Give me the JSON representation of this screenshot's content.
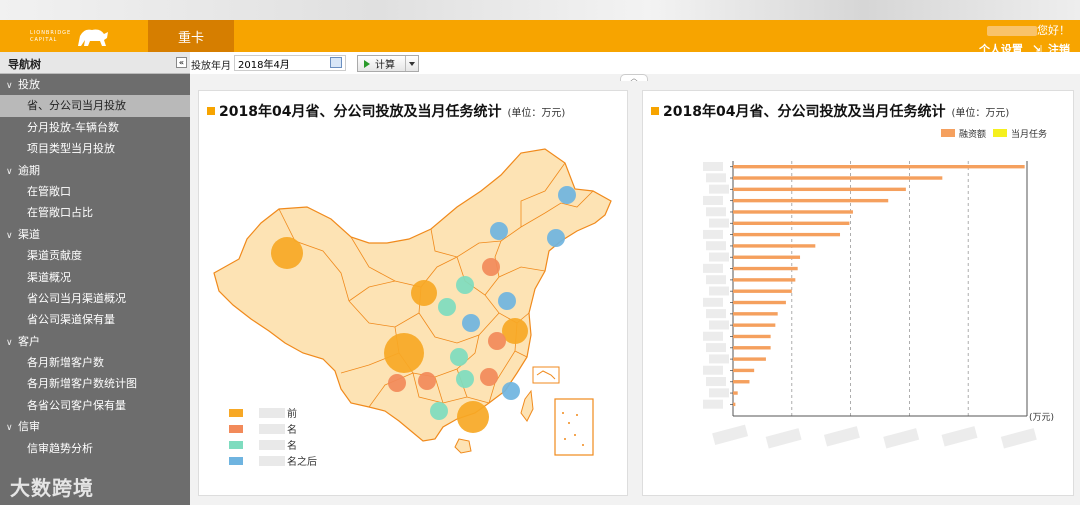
{
  "header": {
    "logo_line1": "LIONBRIDGE",
    "logo_line2": "CAPITAL",
    "active_tab": "重卡",
    "greeting": "您好！",
    "settings_link": "个人设置",
    "logout_link": "注销"
  },
  "sidebar": {
    "title": "导航树",
    "groups": [
      {
        "label": "投放",
        "items": [
          "省、分公司当月投放",
          "分月投放-车辆台数",
          "项目类型当月投放"
        ]
      },
      {
        "label": "逾期",
        "items": [
          "在管敞口",
          "在管敞口占比"
        ]
      },
      {
        "label": "渠道",
        "items": [
          "渠道贡献度",
          "渠道概况",
          "省公司当月渠道概况",
          "省公司渠道保有量"
        ]
      },
      {
        "label": "客户",
        "items": [
          "各月新增客户数",
          "各月新增客户数统计图",
          "各省公司客户保有量"
        ]
      },
      {
        "label": "信审",
        "items": [
          "信审趋势分析"
        ]
      }
    ],
    "active_item": "省、分公司当月投放",
    "watermark": "大数跨境"
  },
  "toolbar": {
    "period_label": "投放年月",
    "period_value": "2018年4月",
    "calc_label": "计算"
  },
  "left_panel": {
    "title": "2018年04月省、分公司投放及当月任务统计",
    "unit": "(单位：万元)",
    "legend": [
      {
        "label": "前",
        "color": "#f7a825"
      },
      {
        "label": "名",
        "color": "#f28a5a"
      },
      {
        "label": "名",
        "color": "#7edcbf"
      },
      {
        "label": "名之后",
        "color": "#6fb4e0"
      }
    ]
  },
  "right_panel": {
    "title": "2018年04月省、分公司投放及当月任务统计",
    "unit": "(单位：万元)",
    "legend": [
      {
        "label": "融资额",
        "color": "#f5a05e"
      },
      {
        "label": "当月任务",
        "color": "#f5f01e"
      }
    ],
    "xunit": "(万元)"
  },
  "chart_data": {
    "type": "bar",
    "orientation": "horizontal",
    "series": [
      {
        "name": "融资额",
        "color": "#f5a05e",
        "values": [
          248,
          178,
          147,
          132,
          102,
          99,
          91,
          70,
          57,
          55,
          53,
          50,
          45,
          38,
          36,
          32,
          32,
          28,
          18,
          14,
          4,
          2
        ]
      },
      {
        "name": "当月任务",
        "color": "#f5f01e",
        "values": []
      }
    ],
    "category_labels_visible": false,
    "grid": "vertical-dashed",
    "xunit": "(万元)"
  },
  "map_data": {
    "type": "bubble-map",
    "region": "China",
    "bubbles": [
      {
        "color_group": 0,
        "size": "large"
      },
      {
        "color_group": 0,
        "size": "xlarge"
      },
      {
        "color_group": 0,
        "size": "large"
      },
      {
        "color_group": 0,
        "size": "medium"
      },
      {
        "color_group": 0,
        "size": "medium"
      },
      {
        "color_group": 1,
        "size": "small"
      },
      {
        "color_group": 1,
        "size": "small"
      },
      {
        "color_group": 1,
        "size": "small"
      },
      {
        "color_group": 1,
        "size": "small"
      },
      {
        "color_group": 1,
        "size": "small"
      },
      {
        "color_group": 2,
        "size": "small"
      },
      {
        "color_group": 2,
        "size": "small"
      },
      {
        "color_group": 2,
        "size": "small"
      },
      {
        "color_group": 2,
        "size": "small"
      },
      {
        "color_group": 2,
        "size": "small"
      },
      {
        "color_group": 3,
        "size": "small"
      },
      {
        "color_group": 3,
        "size": "small"
      },
      {
        "color_group": 3,
        "size": "small"
      },
      {
        "color_group": 3,
        "size": "small"
      },
      {
        "color_group": 3,
        "size": "small"
      },
      {
        "color_group": 3,
        "size": "small"
      }
    ]
  }
}
